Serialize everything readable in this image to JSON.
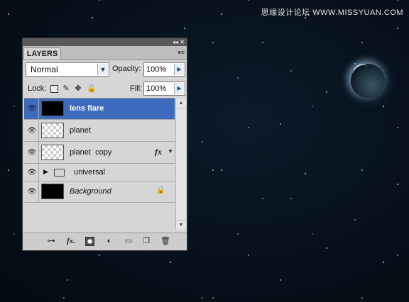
{
  "watermark": "思缘设计论坛 WWW.MISSYUAN.COM",
  "panel": {
    "tab_label": "LAYERS",
    "title_buttons": "◂◂ ✕",
    "menu_icon": "▾≡",
    "blend_mode": "Normal",
    "opacity_label": "Opacity:",
    "opacity_value": "100%",
    "lock_label": "Lock:",
    "fill_label": "Fill:",
    "fill_value": "100%"
  },
  "layers": [
    {
      "name": "lens flare",
      "selected": true,
      "thumbnail": "black"
    },
    {
      "name": "planet",
      "selected": false,
      "thumbnail": "transparent"
    },
    {
      "name": "planet  copy",
      "selected": false,
      "thumbnail": "transparent",
      "fx": "fx"
    },
    {
      "name": "universal",
      "selected": false,
      "type": "group"
    },
    {
      "name": "Background",
      "selected": false,
      "thumbnail": "black",
      "locked": true
    }
  ],
  "icons": {
    "eye": "eye-icon",
    "link": "link-icon",
    "fx": "fx-icon",
    "mask": "mask-icon",
    "adjustment": "adjustment-icon",
    "folder": "folder-icon",
    "new_layer": "new-layer-icon",
    "trash": "trash-icon",
    "lock": "lock-icon"
  },
  "colors": {
    "selection": "#3e6bbd",
    "panel_bg": "#d6d6d6"
  }
}
